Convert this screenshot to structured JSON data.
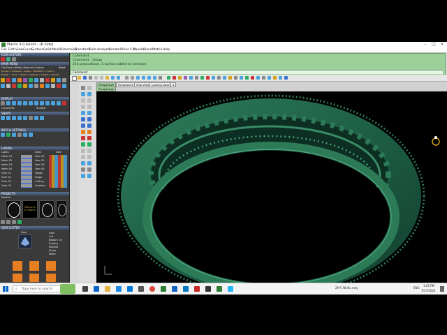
{
  "window": {
    "title": "Matrix 9.0.64-bit - [R Side]"
  },
  "menu": [
    "File",
    "Edit",
    "View",
    "Curve",
    "Surface",
    "Solid",
    "Mesh",
    "Dimension",
    "Transform",
    "Tools",
    "Analyze",
    "Render",
    "Rhino 5.0",
    "Panels",
    "Blend",
    "Matrix",
    "Help"
  ],
  "command": {
    "lines": [
      "Command: _",
      "Command: _Group",
      "216 polysurfaces, 1 surface added to selection."
    ],
    "prompt": "Command:"
  },
  "panels": {
    "history": "ICON HISTORY",
    "main_menu": "MAIN MENU",
    "main_menu_items": "File  Draw  Utilities  Measure  Custom",
    "main_menu_reset": "Reset",
    "breadcrumb1": "Curves > Surfaces > Solids > Transform > Subd >",
    "breadcrumb2": "Builder > Tools > Gems > Settings > Cutters > Render",
    "display": "DISPLAY",
    "display_opt1": "Curves/Pts",
    "display_opt2": "Shaded",
    "snaps": "SNAPS",
    "info": "INFO & SETTINGS",
    "layers": "LAYERS",
    "layers_header": [
      "Lights",
      "Diam",
      "User"
    ],
    "layers_rows": [
      {
        "a": "Metal 01",
        "b": "User 01"
      },
      {
        "a": "Metal 02",
        "b": "User 02"
      },
      {
        "a": "Metal 03",
        "b": "User 03"
      },
      {
        "a": "Metal 04",
        "b": "User 04"
      },
      {
        "a": "Gem 01",
        "b": "Heads"
      },
      {
        "a": "Gem 02",
        "b": "Finger"
      },
      {
        "a": "Gem 03",
        "b": "Cutting"
      },
      {
        "a": "Gem 04",
        "b": "Creation"
      }
    ],
    "projects": "PROJECTS",
    "project_name": "Default",
    "thumb_label": "Welcome to Matrix",
    "gem_cutter": "GEM CUTTER",
    "gem_label": "Gem",
    "gem_options": [
      "Gem",
      "Cut",
      "Bottom On",
      "Surface",
      "Rebuild",
      "Styles",
      "Reset"
    ]
  },
  "view_tabs": [
    "Perspective",
    "Perspective",
    "Side View",
    "Looking Down",
    "4"
  ],
  "view_label": "Perspective",
  "taskbar": {
    "search_placeholder": "Type here to search",
    "weather": "29°C  Nhiều mây",
    "lang": "ENG",
    "time": "1:05 PM",
    "date": "7/17/2024"
  },
  "colors": {
    "model": "#1d5e45",
    "command_bg": "#9ccf9a",
    "panel_bg": "#3a3a3a"
  }
}
